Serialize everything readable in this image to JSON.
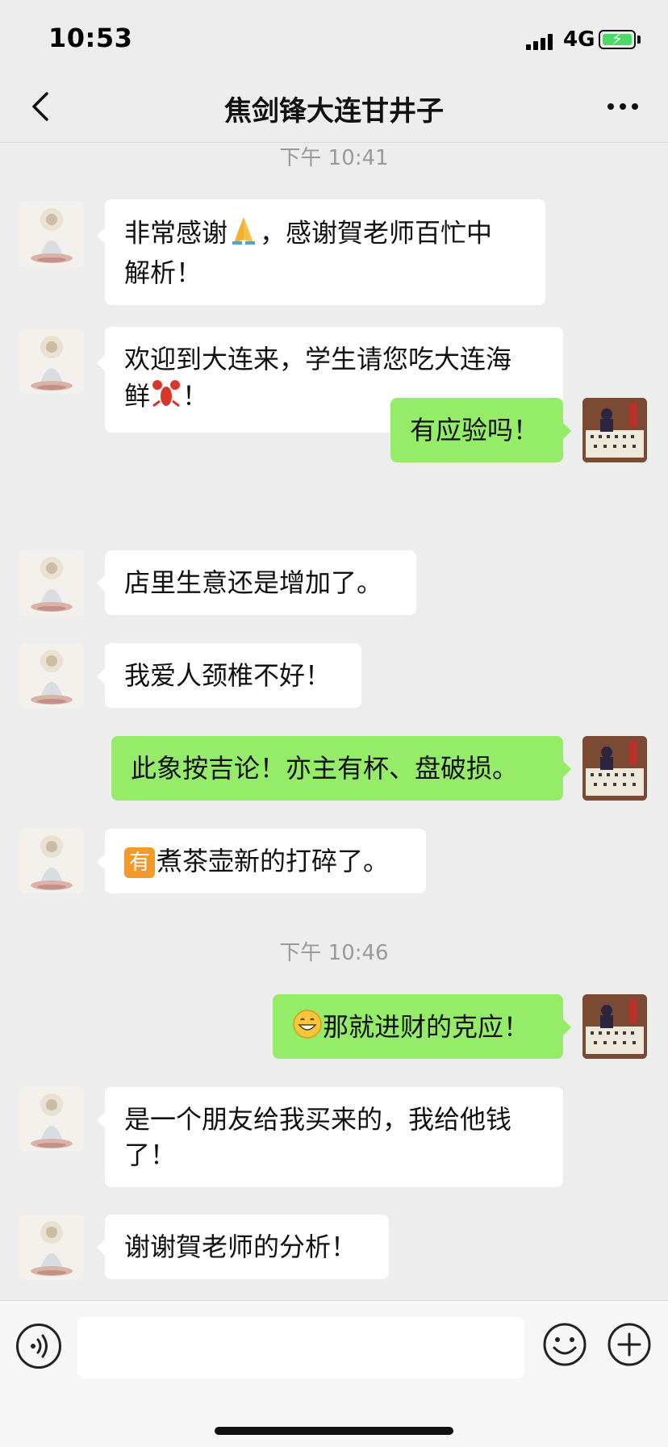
{
  "status_bar": {
    "time": "10:53",
    "network": "4G"
  },
  "nav": {
    "title": "焦剑锋大连甘井子"
  },
  "timestamps": [
    "下午 10:41",
    "下午 10:46"
  ],
  "messages": [
    {
      "side": "them",
      "lines": [
        "非常感谢",
        "，感谢賀老师百忙中",
        "解析！"
      ],
      "emoji": "pray-emoji"
    },
    {
      "side": "them",
      "lines": [
        "欢迎到大连来，学生请您吃大连海",
        "鲜",
        "！"
      ],
      "emoji": "lobster-emoji"
    },
    {
      "side": "me",
      "text": "有应验吗！"
    },
    {
      "side": "them",
      "text": "店里生意还是增加了。"
    },
    {
      "side": "them",
      "text": "我爱人颈椎不好！"
    },
    {
      "side": "me",
      "text": "此象按吉论！亦主有杯、盘破损。"
    },
    {
      "side": "them",
      "badge": "有",
      "text": "煮茶壶新的打碎了。"
    },
    {
      "side": "me",
      "text": "那就进财的克应！",
      "emoji": "grin-emoji"
    },
    {
      "side": "them",
      "lines": [
        "是一个朋友给我买来的，我给他钱",
        "了！"
      ]
    },
    {
      "side": "them",
      "text": "谢谢賀老师的分析！"
    }
  ],
  "colors": {
    "accent": "#95ec69",
    "background": "#ededed",
    "bubble_them": "#ffffff",
    "timestamp": "#9a9a9a"
  },
  "input": {
    "placeholder": ""
  }
}
